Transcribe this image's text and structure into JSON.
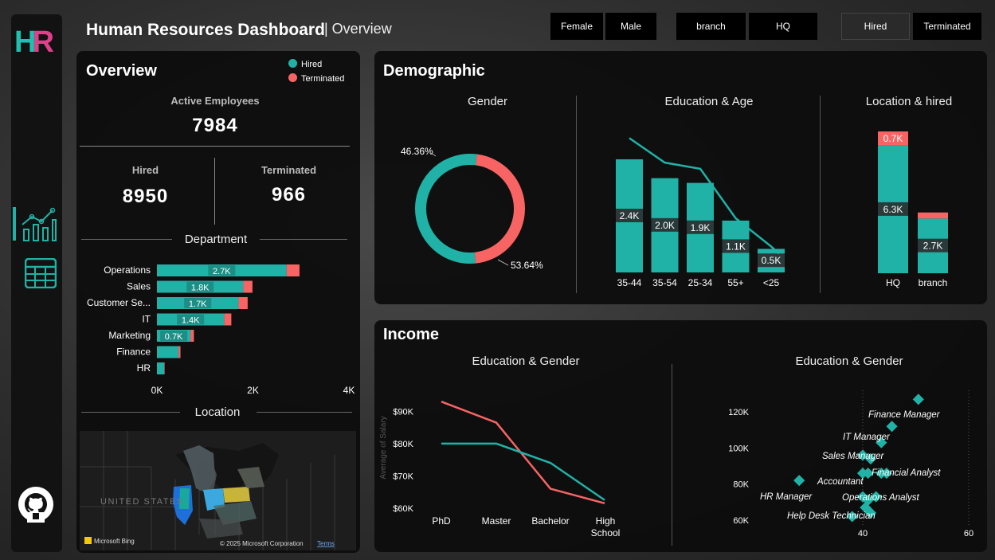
{
  "header": {
    "title": "Human Resources Dashboard",
    "subtitle": "| Overview"
  },
  "filters": {
    "gender": [
      "Female",
      "Male"
    ],
    "location": [
      "branch",
      "HQ"
    ],
    "status": [
      "Hired",
      "Terminated"
    ]
  },
  "sidebar": {
    "logo_h": "H",
    "logo_r": "R"
  },
  "colors": {
    "hired": "#20b2a6",
    "terminated": "#f86464"
  },
  "overview": {
    "title": "Overview",
    "legend": [
      "Hired",
      "Terminated"
    ],
    "active_label": "Active Employees",
    "active_value": "7984",
    "hired_label": "Hired",
    "hired_value": "8950",
    "terminated_label": "Terminated",
    "terminated_value": "966",
    "department_title": "Department",
    "location_title": "Location",
    "map_label": "UNITED STATES",
    "map_brand": "Microsoft Bing",
    "map_copyright": "© 2025 Microsoft Corporation",
    "map_terms": "Terms"
  },
  "demographic": {
    "title": "Demographic",
    "gender_title": "Gender",
    "edu_age_title": "Education & Age",
    "loc_hired_title": "Location & hired"
  },
  "income": {
    "title": "Income",
    "edu_gender_title": "Education & Gender",
    "scatter_title": "Education & Gender"
  },
  "chart_data": [
    {
      "id": "department",
      "type": "bar",
      "orientation": "horizontal",
      "stacked": true,
      "categories": [
        "Operations",
        "Sales",
        "Customer Se...",
        "IT",
        "Marketing",
        "Finance",
        "HR"
      ],
      "series": [
        {
          "name": "Hired",
          "values": [
            2700,
            1800,
            1700,
            1400,
            700,
            450,
            150
          ]
        },
        {
          "name": "Terminated",
          "values": [
            270,
            190,
            190,
            150,
            70,
            40,
            10
          ]
        }
      ],
      "data_labels": [
        "2.7K",
        "1.8K",
        "1.7K",
        "1.4K",
        "0.7K",
        "",
        ""
      ],
      "xticks": [
        "0K",
        "2K",
        "4K"
      ],
      "xlim": [
        0,
        4000
      ]
    },
    {
      "id": "gender",
      "type": "pie",
      "donut": true,
      "slices": [
        {
          "name": "Female",
          "value": 46.36,
          "label": "46.36%"
        },
        {
          "name": "Male",
          "value": 53.64,
          "label": "53.64%"
        }
      ]
    },
    {
      "id": "education_age",
      "type": "bar",
      "categories": [
        "35-44",
        "35-54",
        "25-34",
        "55+",
        "<25"
      ],
      "values": [
        2400,
        2000,
        1900,
        1100,
        500
      ],
      "data_labels": [
        "2.4K",
        "2.0K",
        "1.9K",
        "1.1K",
        "0.5K"
      ],
      "line": [
        2850,
        2330,
        2200,
        1150,
        550
      ]
    },
    {
      "id": "location_hired",
      "type": "bar",
      "stacked": true,
      "categories": [
        "HQ",
        "branch"
      ],
      "series": [
        {
          "name": "Hired",
          "values": [
            6300,
            2700
          ]
        },
        {
          "name": "Terminated",
          "values": [
            700,
            300
          ]
        }
      ],
      "data_labels": {
        "Hired": [
          "6.3K",
          "2.7K"
        ],
        "Terminated": [
          "0.7K",
          ""
        ]
      }
    },
    {
      "id": "income_edu_gender",
      "type": "line",
      "categories": [
        "PhD",
        "Master",
        "Bachelor",
        "High School"
      ],
      "series": [
        {
          "name": "Female",
          "values": [
            93000,
            86500,
            66000,
            61500
          ]
        },
        {
          "name": "Male",
          "values": [
            80000,
            80000,
            74000,
            62500
          ]
        }
      ],
      "ylabel": "Average of Salary",
      "yticks": [
        "$60K",
        "$70K",
        "$80K",
        "$90K"
      ],
      "ylim": [
        57000,
        97000
      ]
    },
    {
      "id": "salary_scatter",
      "type": "scatter",
      "points": [
        {
          "x": 50.5,
          "y": 127000,
          "label": ""
        },
        {
          "x": 45.5,
          "y": 112000,
          "label": "Finance Manager"
        },
        {
          "x": 43.5,
          "y": 103000,
          "label": "IT Manager"
        },
        {
          "x": 40,
          "y": 96000,
          "label": ""
        },
        {
          "x": 41.5,
          "y": 94000,
          "label": "Sales Manager"
        },
        {
          "x": 40,
          "y": 86000,
          "label": ""
        },
        {
          "x": 41,
          "y": 86000,
          "label": "Accountant"
        },
        {
          "x": 43.5,
          "y": 86000,
          "label": ""
        },
        {
          "x": 44.5,
          "y": 86000,
          "label": "Financial Analyst"
        },
        {
          "x": 28,
          "y": 82000,
          "label": "HR Manager"
        },
        {
          "x": 40,
          "y": 73000,
          "label": ""
        },
        {
          "x": 41,
          "y": 71000,
          "label": ""
        },
        {
          "x": 42.5,
          "y": 73000,
          "label": "Operations Analyst"
        },
        {
          "x": 40.5,
          "y": 67000,
          "label": ""
        },
        {
          "x": 41.5,
          "y": 64000,
          "label": "Help Desk Technician"
        },
        {
          "x": 38,
          "y": 62000,
          "label": ""
        }
      ],
      "yticks": [
        "60K",
        "80K",
        "100K",
        "120K"
      ],
      "xticks": [
        "40",
        "60"
      ],
      "xlim": [
        20,
        60
      ],
      "ylim": [
        56000,
        132000
      ]
    }
  ]
}
